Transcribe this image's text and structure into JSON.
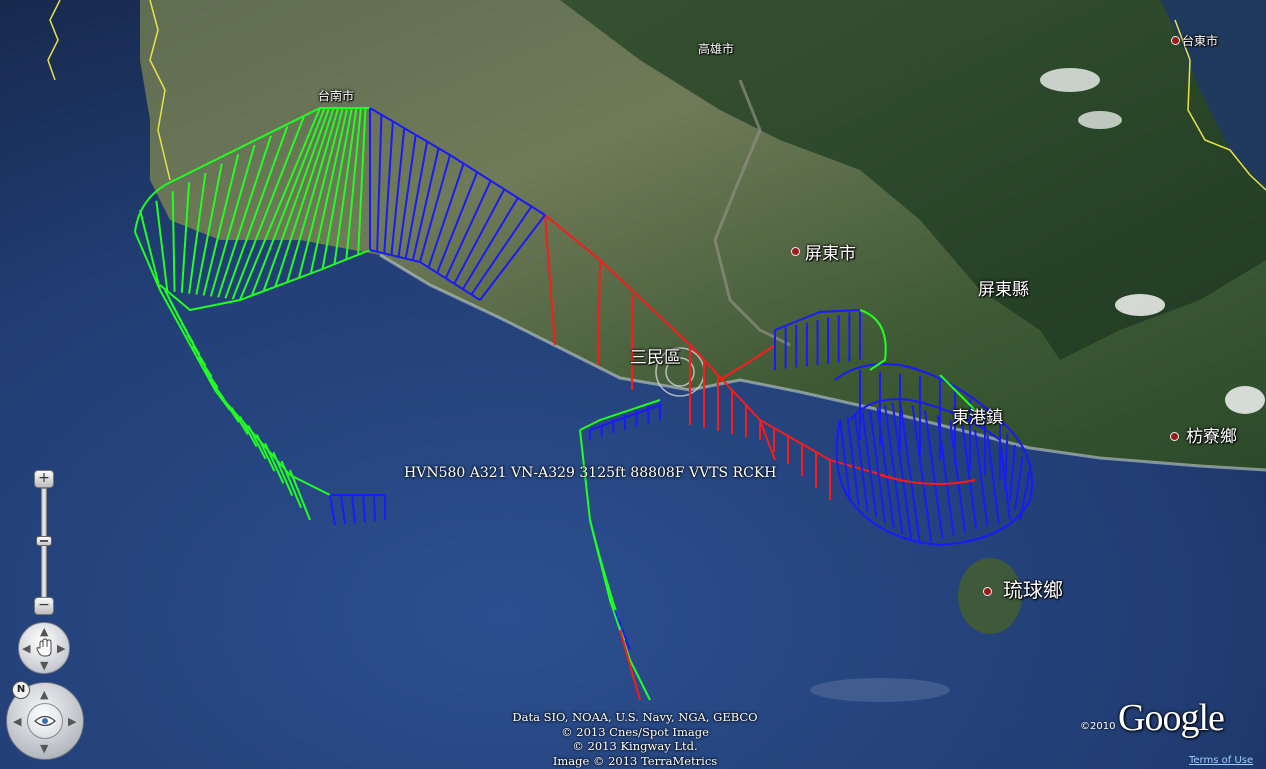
{
  "map": {
    "places": [
      {
        "id": "kaohsiung-city",
        "name": "高雄市",
        "size": "small"
      },
      {
        "id": "tainan-city",
        "name": "台南市",
        "size": "small"
      },
      {
        "id": "taitung-city",
        "name": "台東市",
        "size": "small"
      },
      {
        "id": "pingtung-city",
        "name": "屏東市",
        "size": "big"
      },
      {
        "id": "pingtung-county",
        "name": "屏東縣",
        "size": "big"
      },
      {
        "id": "sanmin",
        "name": "三民區",
        "size": "big"
      },
      {
        "id": "donggang",
        "name": "東港鎮",
        "size": "big"
      },
      {
        "id": "fangliao",
        "name": "枋寮鄉",
        "size": "big"
      },
      {
        "id": "liuqiu",
        "name": "琉球鄉",
        "size": "big"
      }
    ],
    "track_colors": {
      "green": "#22ff22",
      "blue": "#1a1aff",
      "red": "#ff1a1a"
    },
    "flight_label": "HVN580 A321 VN-A329 3125ft 88808F VVTS RCKH"
  },
  "attribution": {
    "lines": [
      "Data SIO, NOAA, U.S. Navy, NGA, GEBCO",
      "© 2013 Cnes/Spot Image",
      "© 2013 Kingway Ltd.",
      "Image © 2013 TerraMetrics"
    ],
    "copyright_year": "©2010",
    "logo": "Google",
    "terms": "Terms of Use"
  },
  "controls": {
    "zoom_in": "+",
    "zoom_out": "−",
    "north": "N"
  }
}
